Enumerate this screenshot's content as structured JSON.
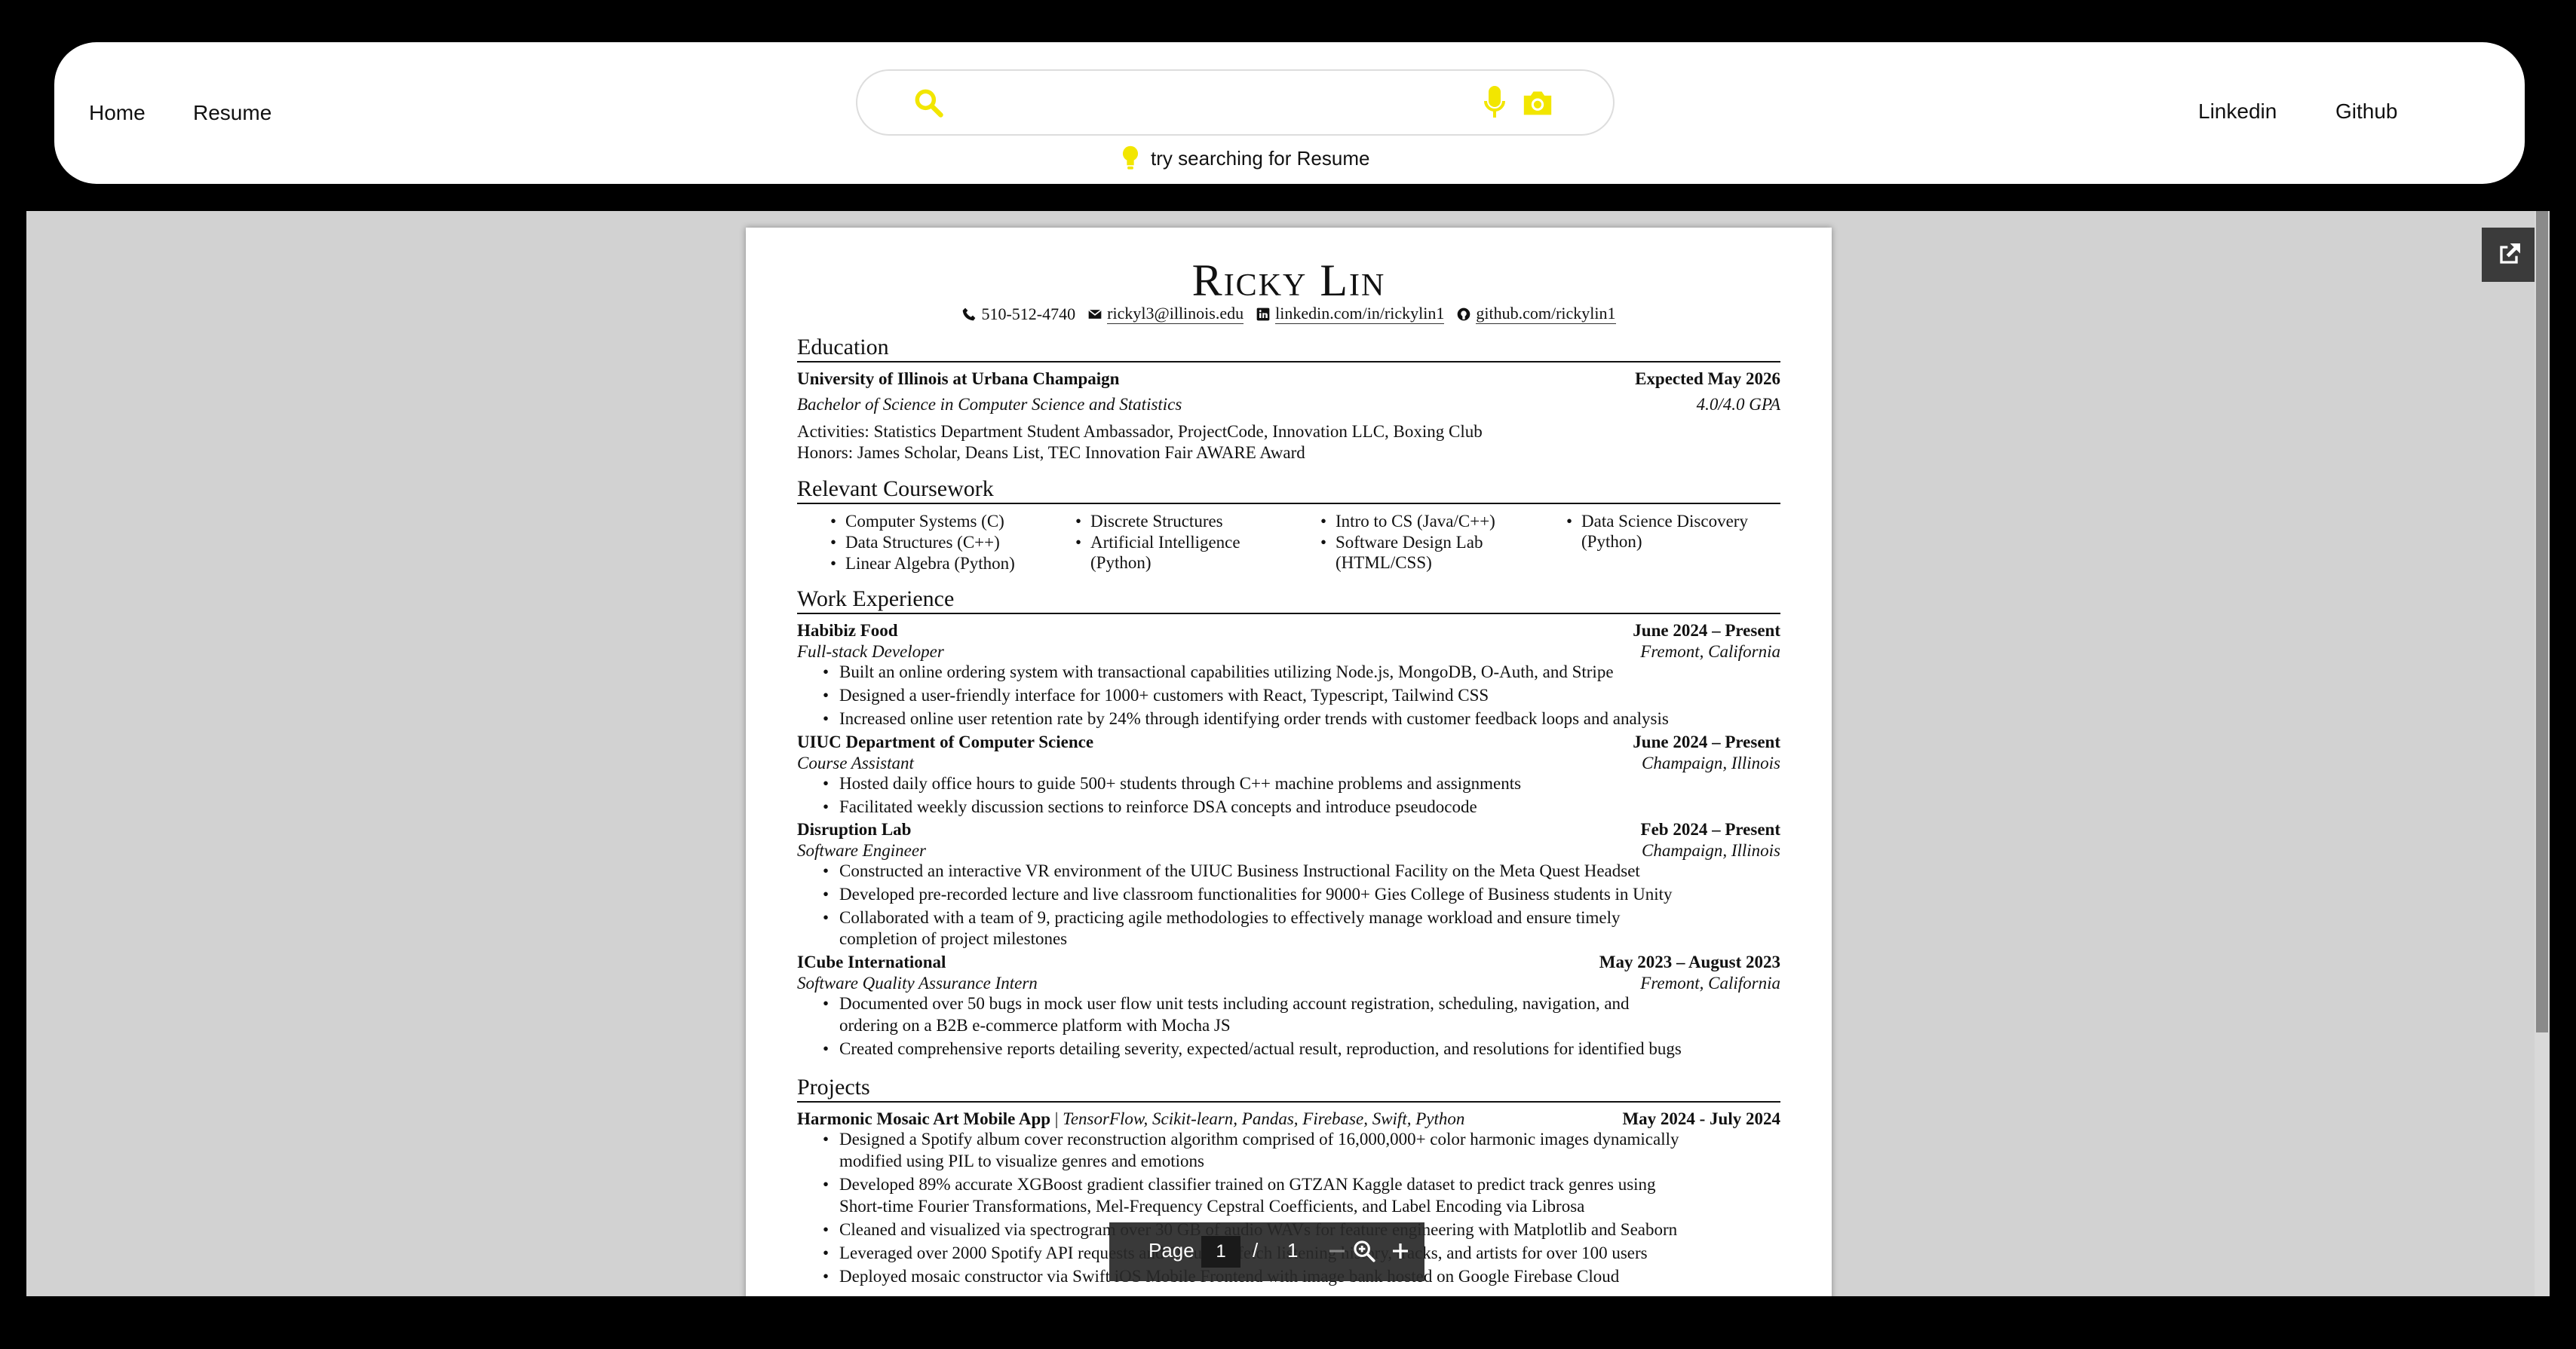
{
  "nav": {
    "left_links": [
      "Home",
      "Resume"
    ],
    "right_links": [
      "Linkedin",
      "Github"
    ],
    "search": {
      "placeholder": "",
      "hint": "try searching for Resume"
    },
    "accent_color": "#f2e600"
  },
  "viewer": {
    "toolbar": {
      "page_label": "Page",
      "current_page": "1",
      "separator": "/",
      "total_pages": "1"
    },
    "icons": [
      "open-external-icon",
      "zoom-out-icon",
      "zoom-icon",
      "zoom-in-icon"
    ]
  },
  "resume": {
    "name": "Ricky Lin",
    "contacts": [
      {
        "icon": "phone-icon",
        "text": "510-512-4740"
      },
      {
        "icon": "email-icon",
        "text": "rickyl3@illinois.edu"
      },
      {
        "icon": "linkedin-icon",
        "text": "linkedin.com/in/rickylin1"
      },
      {
        "icon": "github-icon",
        "text": "github.com/rickylin1"
      }
    ],
    "education": {
      "title": "Education",
      "school": "University of Illinois at Urbana Champaign",
      "date": "Expected May 2026",
      "degree": "Bachelor of Science in Computer Science and Statistics",
      "gpa": "4.0/4.0 GPA",
      "activities": "Activities: Statistics Department Student Ambassador, ProjectCode, Innovation LLC, Boxing Club",
      "honors": "Honors: James Scholar, Deans List, TEC Innovation Fair AWARE Award"
    },
    "coursework": {
      "title": "Relevant Coursework",
      "columns": [
        [
          "Computer Systems (C)",
          "Data Structures (C++)",
          "Linear Algebra (Python)"
        ],
        [
          "Discrete Structures",
          "Artificial Intelligence",
          "(Python)"
        ],
        [
          "Intro to CS (Java/C++)",
          "Software Design Lab",
          "(HTML/CSS)"
        ],
        [
          "Data Science Discovery",
          "(Python)"
        ]
      ]
    },
    "work": {
      "title": "Work Experience",
      "jobs": [
        {
          "company": "Habibiz Food",
          "date": "June 2024 – Present",
          "role": "Full-stack Developer",
          "location": "Fremont, California",
          "bullets": [
            "Built an online ordering system with transactional capabilities utilizing Node.js, MongoDB, O-Auth, and Stripe",
            "Designed a user-friendly interface for 1000+ customers with React, Typescript, Tailwind CSS",
            "Increased online user retention rate by 24% through identifying order trends with customer feedback loops and analysis"
          ]
        },
        {
          "company": "UIUC Department of Computer Science",
          "date": "June 2024 – Present",
          "role": "Course Assistant",
          "location": "Champaign, Illinois",
          "bullets": [
            "Hosted daily office hours to guide 500+ students through C++ machine problems and assignments",
            "Facilitated weekly discussion sections to reinforce DSA concepts and introduce pseudocode"
          ]
        },
        {
          "company": "Disruption Lab",
          "date": "Feb 2024 – Present",
          "role": "Software Engineer",
          "location": "Champaign, Illinois",
          "bullets": [
            "Constructed an interactive VR environment of the UIUC Business Instructional Facility on the Meta Quest Headset",
            "Developed pre-recorded lecture and live classroom functionalities for 9000+ Gies College of Business students in Unity",
            "Collaborated with a team of 9, practicing agile methodologies to effectively manage workload and ensure timely",
            "completion of project milestones"
          ]
        },
        {
          "company": "ICube International",
          "date": "May 2023 – August 2023",
          "role": "Software Quality Assurance Intern",
          "location": "Fremont, California",
          "bullets": [
            "Documented over 50 bugs in mock user flow unit tests including account registration, scheduling, navigation, and",
            "ordering on a B2B e-commerce platform with Mocha JS",
            "Created comprehensive reports detailing severity, expected/actual result, reproduction, and resolutions for identified bugs"
          ]
        }
      ]
    },
    "projects": {
      "title": "Projects",
      "items": [
        {
          "name": "Harmonic Mosaic Art Mobile App",
          "separator": "|",
          "tech": "TensorFlow, Scikit-learn, Pandas, Firebase, Swift, Python",
          "date": "May 2024 - July 2024",
          "bullets": [
            "Designed a Spotify album cover reconstruction algorithm comprised of 16,000,000+ color harmonic images dynamically",
            "modified using PIL to visualize genres and emotions",
            "Developed 89% accurate XGBoost gradient classifier trained on GTZAN Kaggle dataset to predict track genres using",
            "Short-time Fourier Transformations, Mel-Frequency Cepstral Coefficients, and Label Encoding via Librosa",
            "Cleaned and visualized via spectrogram over 30 GB of audio WAVs for feature engineering with Matplotlib and Seaborn",
            "Leveraged over 2000 Spotify API requests and OAuth to fetch listening history, tracks, and artists for over 100 users",
            "Deployed mosaic constructor via Swift iOS Mobile Frontend with image bank hosted on Google Firebase Cloud"
          ]
        }
      ]
    }
  }
}
